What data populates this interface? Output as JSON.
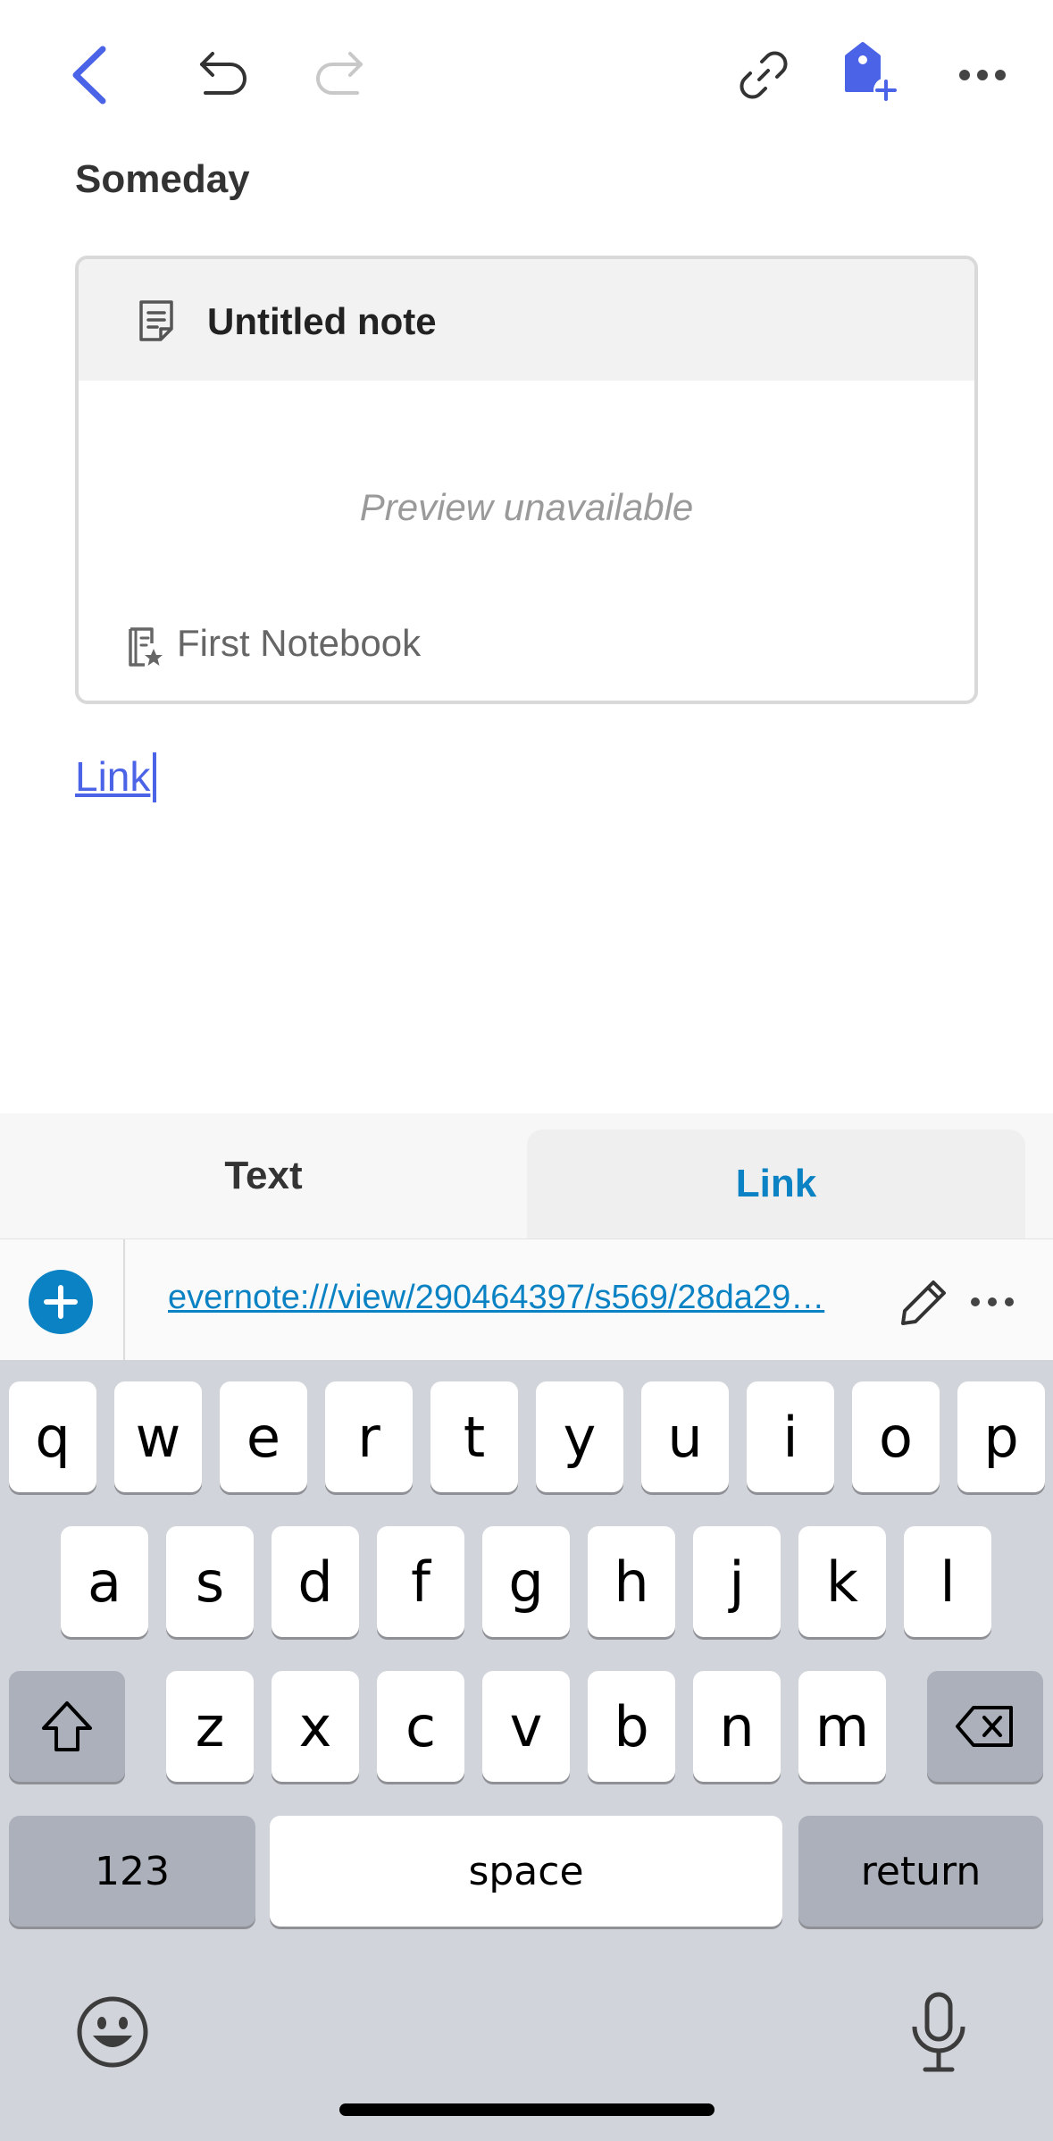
{
  "toolbar": {
    "back_icon": "chevron-left-icon",
    "undo_icon": "undo-icon",
    "redo_icon": "redo-icon",
    "link_icon": "link-icon",
    "tag_icon": "tag-add-icon",
    "more_icon": "more-icon"
  },
  "note": {
    "heading": "Someday",
    "card": {
      "title": "Untitled note",
      "preview": "Preview unavailable",
      "notebook": "First Notebook"
    },
    "link_text": "Link"
  },
  "panel": {
    "tabs": [
      {
        "label": "Text",
        "active": false
      },
      {
        "label": "Link",
        "active": true
      }
    ],
    "url": "evernote:///view/290464397/s569/28da29…"
  },
  "keyboard": {
    "row1": [
      "q",
      "w",
      "e",
      "r",
      "t",
      "y",
      "u",
      "i",
      "o",
      "p"
    ],
    "row2": [
      "a",
      "s",
      "d",
      "f",
      "g",
      "h",
      "j",
      "k",
      "l"
    ],
    "row3": [
      "z",
      "x",
      "c",
      "v",
      "b",
      "n",
      "m"
    ],
    "numbers_label": "123",
    "space_label": "space",
    "return_label": "return"
  },
  "colors": {
    "accent_blue": "#4b63e6",
    "link_blue": "#0a82c3",
    "keyboard_bg": "#d1d4da"
  }
}
